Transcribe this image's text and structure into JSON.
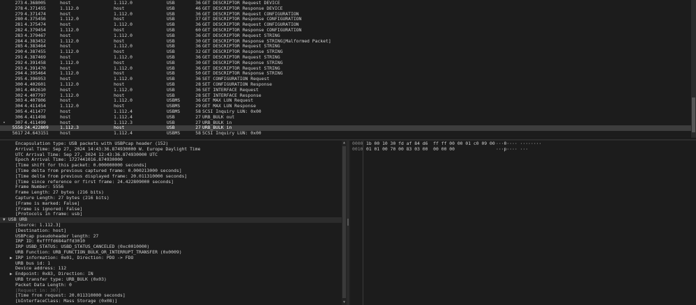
{
  "packets": [
    {
      "no": "273",
      "time": "4.368005",
      "src": "host",
      "dst": "1.112.0",
      "proto": "USB",
      "len": "36",
      "info": "GET DESCRIPTOR Request DEVICE"
    },
    {
      "no": "278",
      "time": "4.371455",
      "src": "1.112.0",
      "dst": "host",
      "proto": "USB",
      "len": "46",
      "info": "GET DESCRIPTOR Response DEVICE"
    },
    {
      "no": "279",
      "time": "4.371474",
      "src": "host",
      "dst": "1.112.0",
      "proto": "USB",
      "len": "36",
      "info": "GET DESCRIPTOR Request CONFIGURATION"
    },
    {
      "no": "280",
      "time": "4.375456",
      "src": "1.112.0",
      "dst": "host",
      "proto": "USB",
      "len": "37",
      "info": "GET DESCRIPTOR Response CONFIGURATION"
    },
    {
      "no": "281",
      "time": "4.375474",
      "src": "host",
      "dst": "1.112.0",
      "proto": "USB",
      "len": "36",
      "info": "GET DESCRIPTOR Request CONFIGURATION"
    },
    {
      "no": "282",
      "time": "4.379454",
      "src": "1.112.0",
      "dst": "host",
      "proto": "USB",
      "len": "60",
      "info": "GET DESCRIPTOR Response CONFIGURATION"
    },
    {
      "no": "283",
      "time": "4.379467",
      "src": "host",
      "dst": "1.112.0",
      "proto": "USB",
      "len": "36",
      "info": "GET DESCRIPTOR Request STRING"
    },
    {
      "no": "284",
      "time": "4.383452",
      "src": "1.112.0",
      "dst": "host",
      "proto": "USB",
      "len": "30",
      "info": "GET DESCRIPTOR Response STRING[Malformed Packet]"
    },
    {
      "no": "285",
      "time": "4.383464",
      "src": "host",
      "dst": "1.112.0",
      "proto": "USB",
      "len": "36",
      "info": "GET DESCRIPTOR Request STRING"
    },
    {
      "no": "290",
      "time": "4.387455",
      "src": "1.112.0",
      "dst": "host",
      "proto": "USB",
      "len": "32",
      "info": "GET DESCRIPTOR Response STRING"
    },
    {
      "no": "291",
      "time": "4.387469",
      "src": "host",
      "dst": "1.112.0",
      "proto": "USB",
      "len": "36",
      "info": "GET DESCRIPTOR Request STRING"
    },
    {
      "no": "292",
      "time": "4.391458",
      "src": "1.112.0",
      "dst": "host",
      "proto": "USB",
      "len": "30",
      "info": "GET DESCRIPTOR Response STRING"
    },
    {
      "no": "293",
      "time": "4.391470",
      "src": "host",
      "dst": "1.112.0",
      "proto": "USB",
      "len": "36",
      "info": "GET DESCRIPTOR Request STRING"
    },
    {
      "no": "294",
      "time": "4.395464",
      "src": "1.112.0",
      "dst": "host",
      "proto": "USB",
      "len": "50",
      "info": "GET DESCRIPTOR Response STRING"
    },
    {
      "no": "295",
      "time": "4.396953",
      "src": "host",
      "dst": "1.112.0",
      "proto": "USB",
      "len": "36",
      "info": "SET CONFIGURATION Request"
    },
    {
      "no": "300",
      "time": "4.402601",
      "src": "1.112.0",
      "dst": "host",
      "proto": "USB",
      "len": "28",
      "info": "SET CONFIGURATION Response"
    },
    {
      "no": "301",
      "time": "4.402610",
      "src": "host",
      "dst": "1.112.0",
      "proto": "USB",
      "len": "36",
      "info": "SET INTERFACE Request"
    },
    {
      "no": "302",
      "time": "4.407797",
      "src": "1.112.0",
      "dst": "host",
      "proto": "USB",
      "len": "28",
      "info": "SET INTERFACE Response"
    },
    {
      "no": "303",
      "time": "4.407806",
      "src": "host",
      "dst": "1.112.0",
      "proto": "USBMS",
      "len": "36",
      "info": "GET MAX LUN Request"
    },
    {
      "no": "304",
      "time": "4.411454",
      "src": "1.112.0",
      "dst": "host",
      "proto": "USBMS",
      "len": "29",
      "info": "GET MAX LUN Response"
    },
    {
      "no": "305",
      "time": "4.411477",
      "src": "host",
      "dst": "1.112.4",
      "proto": "USBMS",
      "len": "58",
      "info": "SCSI Inquiry LUN: 0x00"
    },
    {
      "no": "306",
      "time": "4.411498",
      "src": "host",
      "dst": "1.112.4",
      "proto": "USB",
      "len": "27",
      "info": "URB_BULK out"
    },
    {
      "no": "307",
      "time": "4.411499",
      "src": "host",
      "dst": "1.112.3",
      "proto": "USB",
      "len": "27",
      "info": "URB_BULK in",
      "mark": "•"
    },
    {
      "no": "5556",
      "time": "24.422809",
      "src": "1.112.3",
      "dst": "host",
      "proto": "USB",
      "len": "27",
      "info": "URB_BULK in",
      "selected": true
    },
    {
      "no": "5617",
      "time": "24.643151",
      "src": "host",
      "dst": "1.112.4",
      "proto": "USBMS",
      "len": "58",
      "info": "SCSI Inquiry LUN: 0x00"
    }
  ],
  "details": [
    {
      "text": "Encapsulation type: USB packets with USBPcap header (152)",
      "indent": 1
    },
    {
      "text": "Arrival Time: Sep 27, 2024 14:43:36.874930000 W. Europe Daylight Time",
      "indent": 1
    },
    {
      "text": "UTC Arrival Time: Sep 27, 2024 12:43:36.874930000 UTC",
      "indent": 1
    },
    {
      "text": "Epoch Arrival Time: 1727441016.874930000",
      "indent": 1
    },
    {
      "text": "[Time shift for this packet: 0.000000000 seconds]",
      "indent": 1
    },
    {
      "text": "[Time delta from previous captured frame: 0.000213000 seconds]",
      "indent": 1
    },
    {
      "text": "[Time delta from previous displayed frame: 20.011310000 seconds]",
      "indent": 1
    },
    {
      "text": "[Time since reference or first frame: 24.422809000 seconds]",
      "indent": 1
    },
    {
      "text": "Frame Number: 5556",
      "indent": 1
    },
    {
      "text": "Frame Length: 27 bytes (216 bits)",
      "indent": 1
    },
    {
      "text": "Capture Length: 27 bytes (216 bits)",
      "indent": 1
    },
    {
      "text": "[Frame is marked: False]",
      "indent": 1
    },
    {
      "text": "[Frame is ignored: False]",
      "indent": 1
    },
    {
      "text": "[Protocols in frame: usb]",
      "indent": 1
    },
    {
      "text": "USB URB",
      "indent": 0,
      "arrow": "▼",
      "header": true
    },
    {
      "text": "[Source: 1.112.3]",
      "indent": 1
    },
    {
      "text": "[Destination: host]",
      "indent": 1
    },
    {
      "text": "USBPcap pseudoheader length: 27",
      "indent": 1
    },
    {
      "text": "IRP ID: 0xffffd684affd3010",
      "indent": 1
    },
    {
      "text": "IRP USBD_STATUS: USBD_STATUS_CANCELED (0xc0010000)",
      "indent": 1
    },
    {
      "text": "URB Function: URB_FUNCTION_BULK_OR_INTERRUPT_TRANSFER (0x0009)",
      "indent": 1
    },
    {
      "text": "IRP information: 0x01, Direction: PDO -> FDO",
      "indent": 1,
      "arrow": "▶"
    },
    {
      "text": "URB bus id: 1",
      "indent": 1
    },
    {
      "text": "Device address: 112",
      "indent": 1
    },
    {
      "text": "Endpoint: 0x83, Direction: IN",
      "indent": 1,
      "arrow": "▶"
    },
    {
      "text": "URB transfer type: URB_BULK (0x03)",
      "indent": 1
    },
    {
      "text": "Packet Data Length: 0",
      "indent": 1
    },
    {
      "text": "[Request in: 307]",
      "indent": 1,
      "dim": true
    },
    {
      "text": "[Time from request: 20.011310000 seconds]",
      "indent": 1
    },
    {
      "text": "[bInterfaceClass: Mass Storage (0x08)]",
      "indent": 1
    }
  ],
  "bytes": [
    {
      "offset": "0000",
      "hex": "1b 00 10 30 fd af 84 d6  ff ff 00 00 01 c0 09 00",
      "ascii": "···0···· ········"
    },
    {
      "offset": "0010",
      "hex": "01 01 00 70 00 83 03 00  00 00 00",
      "ascii": "···p···· ···"
    }
  ],
  "colors": {
    "background": "#1e1e1e",
    "selected_row": "#3d3d3d",
    "text": "#d0d0d0"
  }
}
